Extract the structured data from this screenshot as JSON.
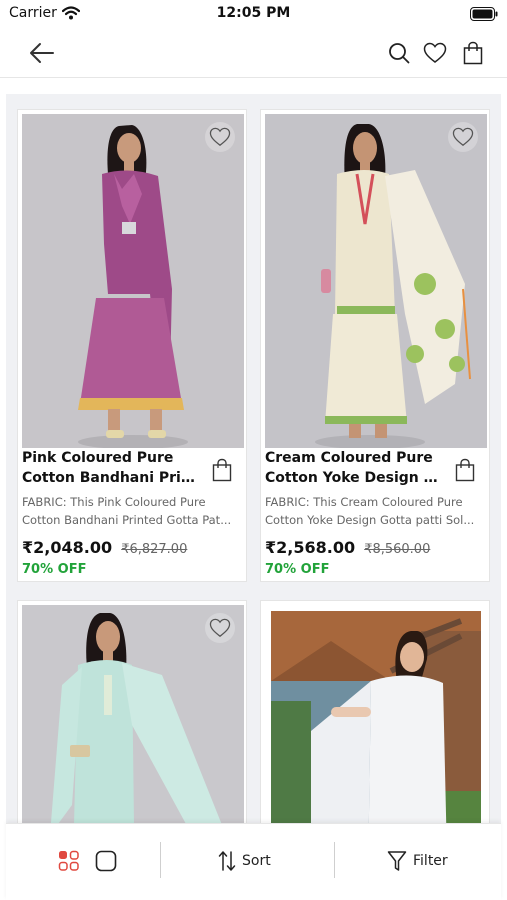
{
  "status_bar": {
    "carrier": "Carrier",
    "time": "12:05 PM"
  },
  "products": [
    {
      "title_line1": "Pink Coloured Pure",
      "title_line2": "Cotton Bandhani Print...",
      "desc_line1": "FABRIC: This Pink Coloured Pure",
      "desc_line2": "Cotton Bandhani Printed Gotta Pat...",
      "price": "₹2,048.00",
      "mrp": "₹6,827.00",
      "discount": "70% OFF"
    },
    {
      "title_line1": "Cream Coloured Pure",
      "title_line2": "Cotton  Yoke Design G...",
      "desc_line1": "FABRIC: This Cream Coloured Pure",
      "desc_line2": "Cotton Yoke Design Gotta patti Sol...",
      "price": "₹2,568.00",
      "mrp": "₹8,560.00",
      "discount": "70% OFF"
    }
  ],
  "bottom_bar": {
    "sort_label": "Sort",
    "filter_label": "Filter"
  },
  "colors": {
    "accent": "#e0483f",
    "discount": "#22a33a",
    "background": "#f0f1f4"
  }
}
